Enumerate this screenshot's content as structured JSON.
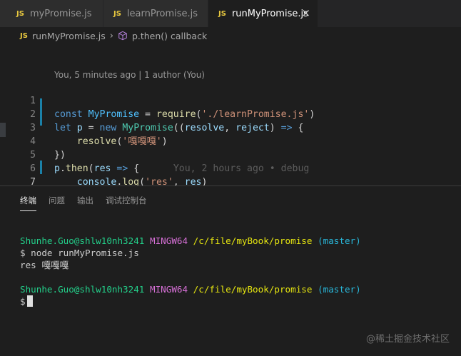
{
  "tabs": [
    {
      "icon": "JS",
      "label": "myPromise.js",
      "active": false
    },
    {
      "icon": "JS",
      "label": "learnPromise.js",
      "active": false
    },
    {
      "icon": "JS",
      "label": "runMyPromise.js",
      "active": true,
      "close": "×"
    }
  ],
  "breadcrumb": {
    "icon": "JS",
    "file": "runMyPromise.js",
    "separator": "›",
    "symbol": "p.then() callback"
  },
  "editor": {
    "codelens": "You, 5 minutes ago | 1 author (You)",
    "line_numbers": [
      "1",
      "2",
      "3",
      "4",
      "5",
      "6",
      "7"
    ],
    "line1": {
      "t1": "const ",
      "t2": "MyPromise",
      "t3": " = ",
      "t4": "require",
      "t5": "(",
      "t6": "'./learnPromise.js'",
      "t7": ")"
    },
    "line2": {
      "t1": "let ",
      "t2": "p",
      "t3": " = ",
      "t4": "new ",
      "t5": "MyPromise",
      "t6": "((",
      "t7": "resolve",
      "t8": ", ",
      "t9": "reject",
      "t10": ") ",
      "t11": "=>",
      "t12": " {"
    },
    "line3": {
      "t1": "    ",
      "t2": "resolve",
      "t3": "(",
      "t4": "'嘎嘎嘎'",
      "t5": ")"
    },
    "line4": {
      "t1": "})"
    },
    "line5": {
      "t1": "p",
      "t2": ".",
      "t3": "then",
      "t4": "(",
      "t5": "res",
      "t6": " ",
      "t7": "=>",
      "t8": " {",
      "t9": "      You, 2 hours ago • debug"
    },
    "line6": {
      "t1": "    ",
      "t2": "console",
      "t3": ".",
      "t4": "log",
      "t5": "(",
      "t6": "'res'",
      "t7": ", ",
      "t8": "res",
      "t9": ")"
    },
    "line7": {
      "t1": "},",
      "t2": "()",
      "t3": "=>",
      "t4": "{})"
    }
  },
  "panel": {
    "tabs": [
      "终端",
      "问题",
      "输出",
      "调试控制台"
    ],
    "terminal": {
      "user1": "Shunhe.Guo@shlw10nh3241",
      "env1": "MINGW64",
      "path1": "/c/file/myBook/promise",
      "branch1": "(master)",
      "cmd": "$ node runMyPromise.js",
      "output": "res 嘎嘎嘎",
      "user2": "Shunhe.Guo@shlw10nh3241",
      "env2": "MINGW64",
      "path2": "/c/file/myBook/promise",
      "branch2": "(master)",
      "prompt": "$"
    }
  },
  "watermark": "@稀土掘金技术社区",
  "colors": {
    "accent": "#1b81a8",
    "js_icon": "#e8c83f",
    "background": "#1e1e1e"
  }
}
